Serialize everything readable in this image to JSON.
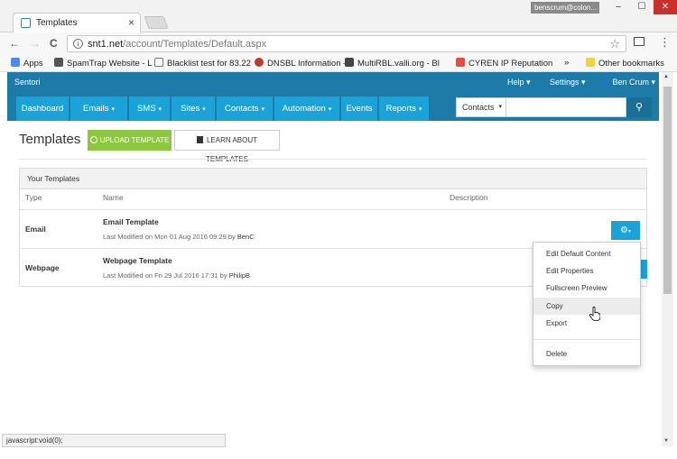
{
  "browser": {
    "tab_title": "Templates",
    "tab_close": "×",
    "profile": "benscrum@colon...",
    "url_domain": "snt1.net",
    "url_path": "/account/Templates/Default.aspx",
    "back": "←",
    "forward": "→",
    "reload": "C",
    "star": "☆",
    "menu": "⋮",
    "minimize": "–",
    "maximize": "☐",
    "close": "✕",
    "info": "i"
  },
  "bookmarks": {
    "items": [
      {
        "label": "Apps",
        "color": "#4a8af4"
      },
      {
        "label": "SpamTrap Website - L",
        "color": "#555555"
      },
      {
        "label": "Blacklist test for 83.22",
        "color": "#777777"
      },
      {
        "label": "DNSBL Information -",
        "color": "#c0392b"
      },
      {
        "label": "MultiRBL.valli.org - Bl",
        "color": "#444444"
      },
      {
        "label": "CYREN IP Reputation",
        "color": "#e74c3c"
      }
    ],
    "more": "»",
    "other": "Other bookmarks"
  },
  "app": {
    "brand": "Sentori",
    "help": "Help ▾",
    "settings": "Settings ▾",
    "user": "Ben Crum ▾",
    "user_icon": "👤",
    "nav": [
      "Dashboard",
      "Emails",
      "SMS",
      "Sites",
      "Contacts",
      "Automation",
      "Events",
      "Reports"
    ],
    "caret": "▾",
    "search_select": "Contacts",
    "search_icon": "⚲"
  },
  "page": {
    "title": "Templates",
    "upload_button": "UPLOAD TEMPLATE",
    "learn_button": "LEARN ABOUT TEMPLATES"
  },
  "panel": {
    "heading": "Your Templates",
    "columns": {
      "type": "Type",
      "name": "Name",
      "description": "Description"
    },
    "rows": [
      {
        "type": "Email",
        "name": "Email Template",
        "meta": "Last Modified on Mon 01 Aug 2016 09:29 by",
        "who": "BenC"
      },
      {
        "type": "Webpage",
        "name": "Webpage Template",
        "meta": "Last Modified on Fri 29 Jul 2016 17:31 by",
        "who": "PhilipB"
      }
    ],
    "gear": "⚙"
  },
  "dropdown": {
    "items": [
      "Edit Default Content",
      "Edit Properties",
      "Fullscreen Preview",
      "Copy",
      "Export"
    ],
    "delete": "Delete"
  },
  "status": {
    "text": "javascript:void(0);"
  }
}
